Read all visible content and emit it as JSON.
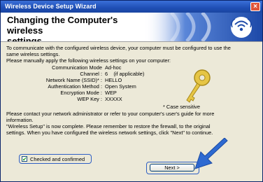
{
  "window": {
    "title": "Wireless Device Setup Wizard"
  },
  "header": {
    "title_line1": "Changing the Computer's wireless",
    "title_line2": "settings."
  },
  "intro": {
    "line1": "To communicate with the configured wireless device, your computer must be configured to use the",
    "line2": "same wireless settings.",
    "line3": "Please manually apply the following wireless settings on your computer:"
  },
  "settings": [
    {
      "label": "Communication Mode",
      "value": "Ad-hoc"
    },
    {
      "label": "Channel :",
      "value": "6    (if applicable)"
    },
    {
      "label": "Network Name (SSID)* :",
      "value": "HELLO"
    },
    {
      "label": "Authentication Method :",
      "value": "Open System"
    },
    {
      "label": "Encryption Mode :",
      "value": "WEP"
    },
    {
      "label": "WEP Key :",
      "value": "XXXXX"
    }
  ],
  "note": "* Case sensitive",
  "contact": {
    "line1": "Please contact your network administrator or refer to your computer's user's guide for more",
    "line2": "information."
  },
  "complete": {
    "line1": "\"Wireless Setup\" is now complete. Please remember to restore the firewall, to the original",
    "line2": "settings. When you have configured the wireless network settings, click \"Next\" to continue."
  },
  "checkbox": {
    "label": "Checked and confirmed",
    "checked": true
  },
  "buttons": {
    "next_label": "Next >"
  },
  "icons": {
    "close": "close-icon",
    "key": "key-icon",
    "arrow": "arrow-icon",
    "wireless": "wireless-icon"
  },
  "colors": {
    "titlebar": "#2a5ac8",
    "highlight_border": "#2e5fc4",
    "arrow": "#2e6ad1"
  }
}
